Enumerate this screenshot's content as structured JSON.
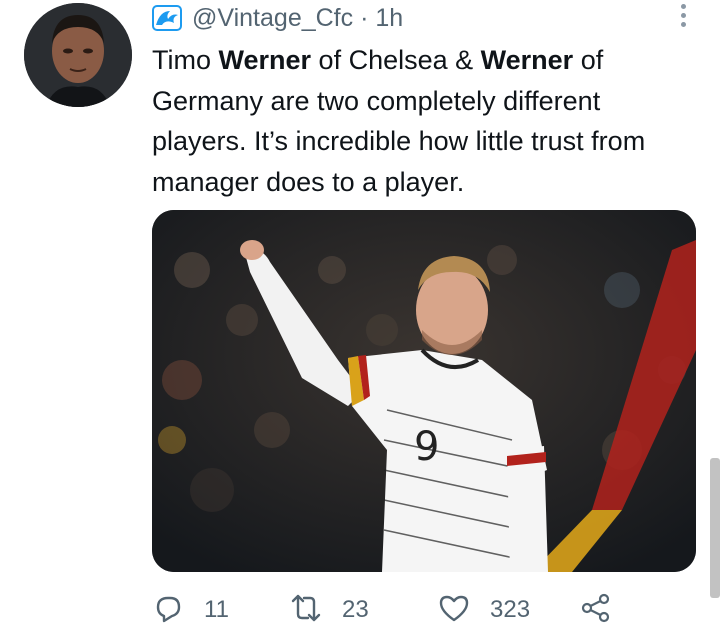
{
  "tweet": {
    "handle": "@Vintage_Cfc",
    "separator": "·",
    "time": "1h",
    "text_parts": [
      {
        "text": "Timo ",
        "bold": false
      },
      {
        "text": "Werner",
        "bold": true
      },
      {
        "text": " of Chelsea & ",
        "bold": false
      },
      {
        "text": "Werner",
        "bold": true
      },
      {
        "text": " of Germany are two completely different players. It’s incredible how little trust from manager does to a player.",
        "bold": false
      }
    ],
    "media": {
      "description_icon": "photo",
      "jersey_number": "9"
    }
  },
  "actions": {
    "reply_count": "11",
    "retweet_count": "23",
    "like_count": "323"
  },
  "colors": {
    "accent_blue": "#1d9bf0",
    "secondary_text": "#536471",
    "primary_text": "#0f1419"
  },
  "icons": {
    "badge": "wave-badge-icon",
    "more": "more-vertical-icon",
    "reply": "reply-icon",
    "retweet": "retweet-icon",
    "like": "heart-icon",
    "share": "share-icon"
  }
}
